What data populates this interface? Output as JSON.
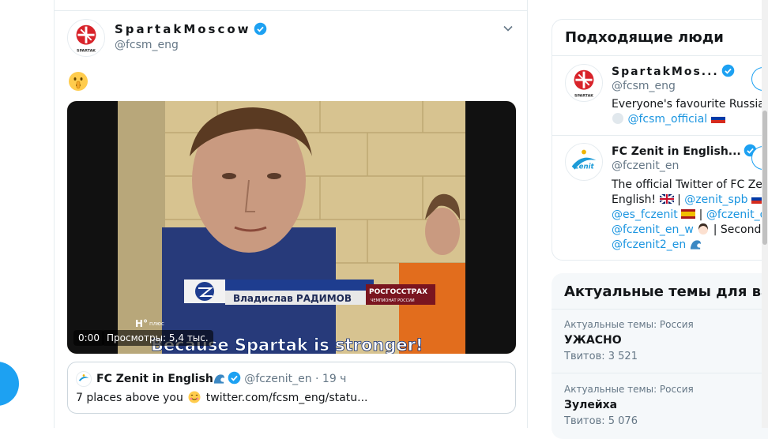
{
  "tweet": {
    "name": "SpartakMoscow",
    "handle": "@fcsm_eng",
    "emoji": "shushing-face",
    "video": {
      "time": "0:00",
      "views": "Просмотры: 5,4 тыс.",
      "caption_name": "Владислав РАДИМОВ",
      "caption_sponsor": "РОСГОССТРАХ",
      "caption_sponsor_sub": "ЧЕМПИОНАТ РОССИИ",
      "subtitle": "Because Spartak is stronger!",
      "channel_badge": "Н°",
      "channel_badge_sub": "плюс"
    },
    "quote": {
      "name": "FC Zenit in English",
      "handle": "@fczenit_en",
      "separator": "·",
      "time": "19 ч",
      "text_before": "7 places above you",
      "text_after": "twitter.com/fcsm_eng/statu..."
    }
  },
  "who_to_follow": {
    "title": "Подходящие люди",
    "users": [
      {
        "name": "SpartakMos...",
        "handle": "@fcsm_eng",
        "bio_line1": "Everyone's favourite Russian te",
        "bio_line2_link": "@fcsm_official"
      },
      {
        "name": "FC Zenit in English...",
        "handle": "@fczenit_en",
        "bio_line1": "The official Twitter of FC Zenit",
        "bio_line2_pre": "English!",
        "bio_line2_link": "@zenit_spb",
        "bio_line3_link1": "@es_fczenit",
        "bio_line3_link2": "@fczenit_de",
        "bio_line4_link": "@fczenit_en_w",
        "bio_line4_post": "| Second te",
        "bio_line5_link": "@fczenit2_en"
      }
    ]
  },
  "trends": {
    "title": "Актуальные темы для вас",
    "items": [
      {
        "category": "Актуальные темы: Россия",
        "name": "УЖАСНО",
        "count": "Твитов: 3 521"
      },
      {
        "category": "Актуальные темы: Россия",
        "name": "Зулейха",
        "count": "Твитов: 5 076"
      }
    ]
  },
  "colors": {
    "accent": "#1da1f2",
    "link": "#1b95e0",
    "muted": "#657786",
    "spartak_red": "#d8232a",
    "zenit_blue": "#1d9bd7"
  }
}
